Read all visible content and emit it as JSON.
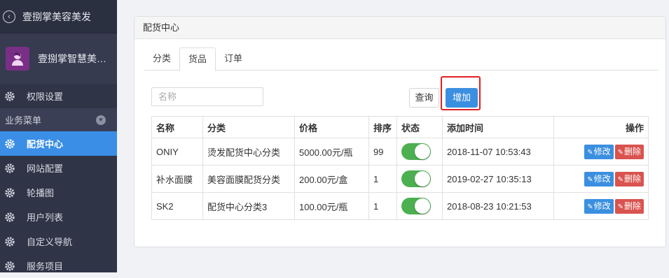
{
  "sidebar": {
    "app_title": "壹捌掌美容美发",
    "profile_name": "壹捌掌智慧美容美发",
    "items_top": [
      {
        "label": "权限设置",
        "icon": "gear-icon"
      }
    ],
    "group_label": "业务菜单",
    "items": [
      {
        "label": "配货中心",
        "icon": "gear-icon",
        "active": true
      },
      {
        "label": "网站配置",
        "icon": "gear-icon",
        "active": false
      },
      {
        "label": "轮播图",
        "icon": "gear-icon",
        "active": false
      },
      {
        "label": "用户列表",
        "icon": "gear-icon",
        "active": false
      },
      {
        "label": "自定义导航",
        "icon": "gear-icon",
        "active": false
      },
      {
        "label": "服务项目",
        "icon": "gear-icon",
        "active": false
      }
    ],
    "active_color": "#3a8ee6"
  },
  "panel": {
    "title": "配货中心",
    "tabs": [
      {
        "label": "分类",
        "active": false
      },
      {
        "label": "货品",
        "active": true
      },
      {
        "label": "订单",
        "active": false
      }
    ],
    "search": {
      "placeholder": "名称",
      "value": ""
    },
    "query_label": "查询",
    "add_label": "增加"
  },
  "table": {
    "headers": [
      "名称",
      "分类",
      "价格",
      "排序",
      "状态",
      "添加时间",
      "操作"
    ],
    "rows": [
      {
        "name": "ONIY",
        "category": "烫发配货中心分类",
        "price": "5000.00元/瓶",
        "sort": "99",
        "status": true,
        "time": "2018-11-07 10:53:43"
      },
      {
        "name": "补水面膜",
        "category": "美容面膜配货分类",
        "price": "200.00元/盒",
        "sort": "1",
        "status": true,
        "time": "2019-02-27 10:35:13"
      },
      {
        "name": "SK2",
        "category": "配货中心分类3",
        "price": "100.00元/瓶",
        "sort": "1",
        "status": true,
        "time": "2018-08-23 10:21:53"
      }
    ],
    "edit_label": "修改",
    "delete_label": "删除",
    "toggle_color": "#4cb050"
  }
}
